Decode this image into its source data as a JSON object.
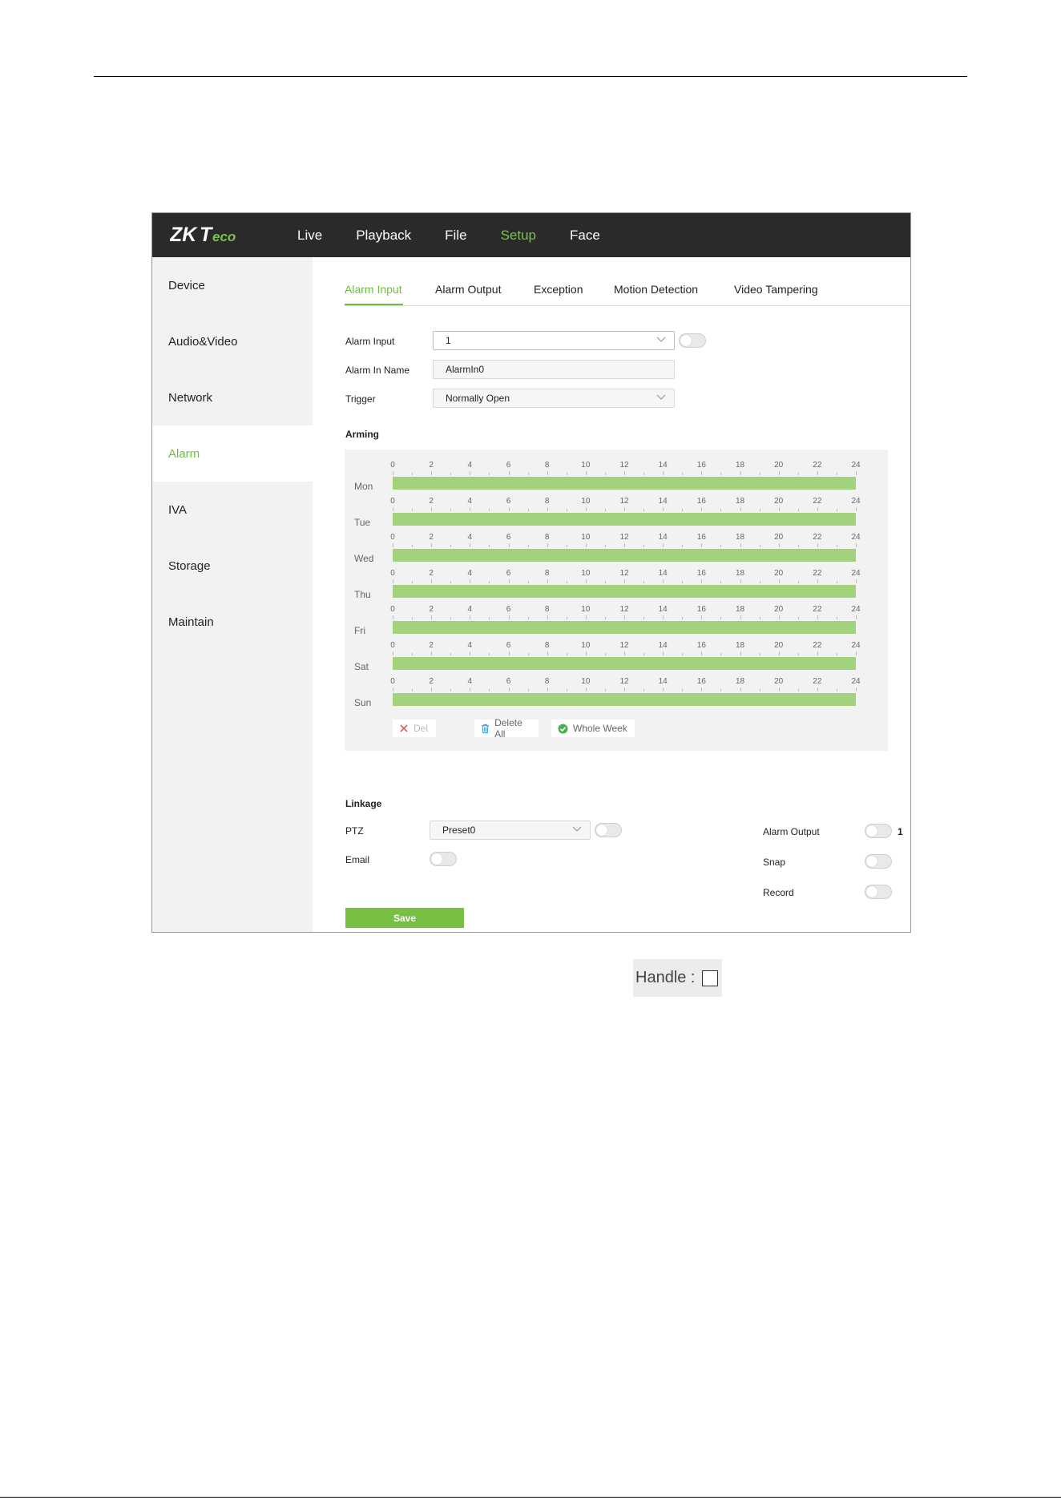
{
  "header": {
    "logo_text": "ZKTeco",
    "nav": [
      "Live",
      "Playback",
      "File",
      "Setup",
      "Face"
    ],
    "active_nav": "Setup"
  },
  "sidebar": {
    "items": [
      "Device",
      "Audio&Video",
      "Network",
      "Alarm",
      "IVA",
      "Storage",
      "Maintain"
    ],
    "active": "Alarm"
  },
  "tabs": {
    "items": [
      "Alarm Input",
      "Alarm Output",
      "Exception",
      "Motion Detection",
      "Video Tampering"
    ],
    "active": "Alarm Input"
  },
  "form": {
    "alarm_input_label": "Alarm Input",
    "alarm_input_value": "1",
    "alarm_in_name_label": "Alarm In Name",
    "alarm_in_name_value": "AlarmIn0",
    "trigger_label": "Trigger",
    "trigger_value": "Normally Open"
  },
  "arming": {
    "title": "Arming",
    "ticks": [
      "0",
      "2",
      "4",
      "6",
      "8",
      "10",
      "12",
      "14",
      "16",
      "18",
      "20",
      "22",
      "24"
    ],
    "days": [
      "Mon",
      "Tue",
      "Wed",
      "Thu",
      "Fri",
      "Sat",
      "Sun"
    ],
    "armed_ranges_hours": [
      [
        0,
        24
      ],
      [
        0,
        24
      ],
      [
        0,
        24
      ],
      [
        0,
        24
      ],
      [
        0,
        24
      ],
      [
        0,
        24
      ],
      [
        0,
        24
      ]
    ],
    "del_label": "Del",
    "delete_all_label": "Delete All",
    "whole_week_label": "Whole Week"
  },
  "linkage": {
    "title": "Linkage",
    "ptz_label": "PTZ",
    "ptz_value": "Preset0",
    "email_label": "Email",
    "alarm_output_label": "Alarm Output",
    "alarm_output_channel": "1",
    "snap_label": "Snap",
    "record_label": "Record"
  },
  "save_label": "Save",
  "handle": {
    "label": "Handle :"
  },
  "colors": {
    "accent": "#6cbf3c",
    "armed_bar": "#a2d37c",
    "topbar": "#2a2a2a"
  }
}
